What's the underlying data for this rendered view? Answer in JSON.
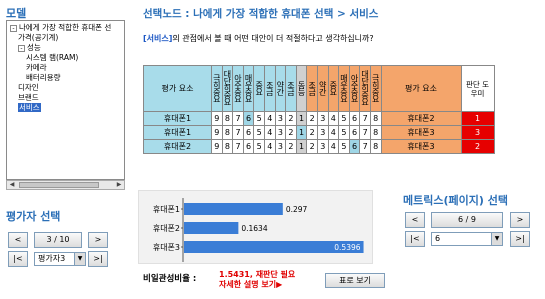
{
  "left": {
    "model_title": "모델",
    "tree": [
      {
        "text": "나에게 가장 적합한 휴대폰 선",
        "indent": 0,
        "exp": "-"
      },
      {
        "text": "가격(공기계)",
        "indent": 1,
        "exp": ""
      },
      {
        "text": "성능",
        "indent": 1,
        "exp": "-"
      },
      {
        "text": "시스템 램(RAM)",
        "indent": 2,
        "exp": ""
      },
      {
        "text": "카메라",
        "indent": 2,
        "exp": ""
      },
      {
        "text": "배터리용량",
        "indent": 2,
        "exp": ""
      },
      {
        "text": "디자인",
        "indent": 1,
        "exp": ""
      },
      {
        "text": "브랜드",
        "indent": 1,
        "exp": ""
      },
      {
        "text": "서비스",
        "indent": 1,
        "exp": "",
        "selected": true
      }
    ],
    "evaluator_title": "평가자 선택",
    "prev": "<",
    "page": "3 / 10",
    "next": ">",
    "first": "|<",
    "evaluator_value": "평가자3",
    "last": ">|"
  },
  "header": {
    "node_title": "선택노드 : 나에게 가장 적합한 휴대폰 선택 > 서비스",
    "question_bracket": "[서비스]",
    "question_rest": "의 관점에서 볼 때 어떤 대안이 더 적절하다고 생각하십니까?"
  },
  "table": {
    "left_header": "평가 요소",
    "right_header": "평가 요소",
    "judge_header": "판단 도우미",
    "scale_labels_left": [
      "극히중요",
      "대단히중요",
      "아주중요",
      "매우중요",
      "중요",
      "조금",
      "약간",
      "조금"
    ],
    "same_label": "동등",
    "scale_labels_right": [
      "조금",
      "약간",
      "중요",
      "매우중요",
      "아주중요",
      "대단히중요",
      "극히중요"
    ],
    "rows": [
      {
        "left": "휴대폰1",
        "left_nums": [
          "9",
          "8",
          "7",
          "6",
          "5",
          "4",
          "3",
          "2"
        ],
        "left_sel": 3,
        "mid": "1",
        "right_nums": [
          "2",
          "3",
          "4",
          "5",
          "6",
          "7",
          "8",
          "9"
        ],
        "right_sel": -1,
        "right": "휴대폰2",
        "judge": "1"
      },
      {
        "left": "휴대폰1",
        "left_nums": [
          "9",
          "8",
          "7",
          "6",
          "5",
          "4",
          "3",
          "2"
        ],
        "left_sel": -1,
        "mid": "1",
        "right_nums": [
          "2",
          "3",
          "4",
          "5",
          "6",
          "7",
          "8",
          "9"
        ],
        "right_sel": -1,
        "right": "휴대폰3",
        "judge": "3",
        "mid_sel": true
      },
      {
        "left": "휴대폰2",
        "left_nums": [
          "9",
          "8",
          "7",
          "6",
          "5",
          "4",
          "3",
          "2"
        ],
        "left_sel": -1,
        "mid": "1",
        "right_nums": [
          "2",
          "3",
          "4",
          "5",
          "6",
          "7",
          "8",
          "9"
        ],
        "right_sel": 4,
        "right": "휴대폰3",
        "judge": "2"
      }
    ]
  },
  "chart_data": {
    "type": "bar",
    "categories": [
      "휴대폰1",
      "휴대폰2",
      "휴대폰3"
    ],
    "values": [
      0.297,
      0.1634,
      0.5396
    ],
    "value_labels": [
      "0.297",
      "0.1634",
      "0.5396"
    ],
    "bar_color": "#3a7dd6",
    "xlim": [
      0,
      0.55
    ]
  },
  "consistency": {
    "label": "비일관성비율 :",
    "value_line1": "1.5431, 재판단 필요",
    "value_line2": "자세한 설명 보기▶",
    "show_button": "표로 보기"
  },
  "matrix": {
    "title": "메트릭스(페이지) 선택",
    "prev": "<",
    "page": "6 / 9",
    "next": ">",
    "first": "|<",
    "select_value": "6",
    "last": ">|"
  }
}
